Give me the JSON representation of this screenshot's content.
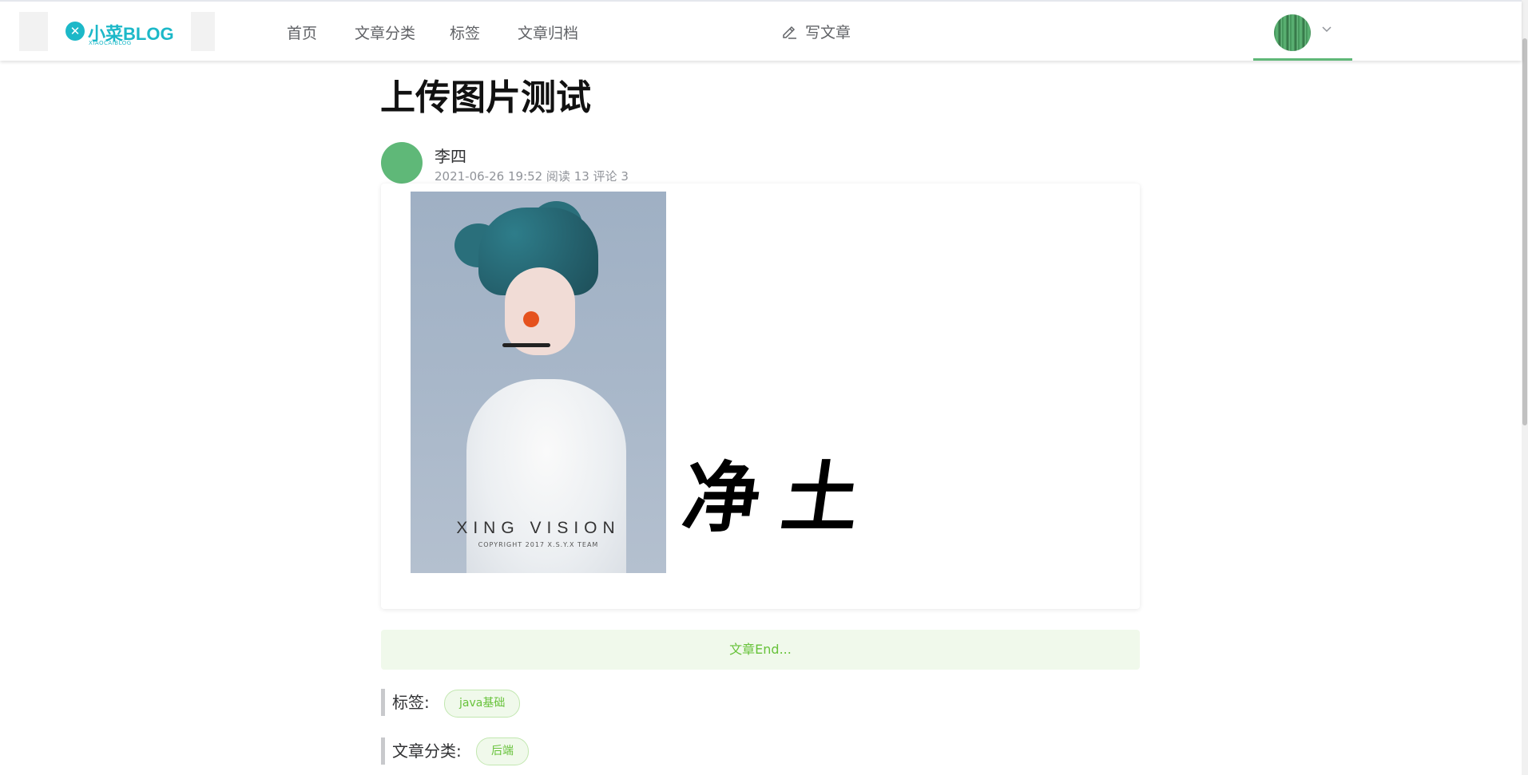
{
  "header": {
    "logo": {
      "text": "小菜BLOG",
      "subtext": "XIAOCAIBLOG"
    },
    "nav": [
      "首页",
      "文章分类",
      "标签",
      "文章归档"
    ],
    "write_label": "写文章"
  },
  "article": {
    "title": "上传图片测试",
    "author": "李四",
    "meta": "2021-06-26 19:52 阅读 13 评论 3",
    "image": {
      "caption": "XING VISION",
      "copyright": "COPYRIGHT 2017 X.S.Y.X TEAM"
    },
    "calligraphy": "净土",
    "end_text": "文章End...",
    "tags_label": "标签:",
    "tags": [
      "java基础"
    ],
    "category_label": "文章分类:",
    "categories": [
      "后端"
    ]
  },
  "colors": {
    "accent": "#5fb878",
    "tag_bg": "#f0f9eb",
    "tag_text": "#67c23a"
  }
}
